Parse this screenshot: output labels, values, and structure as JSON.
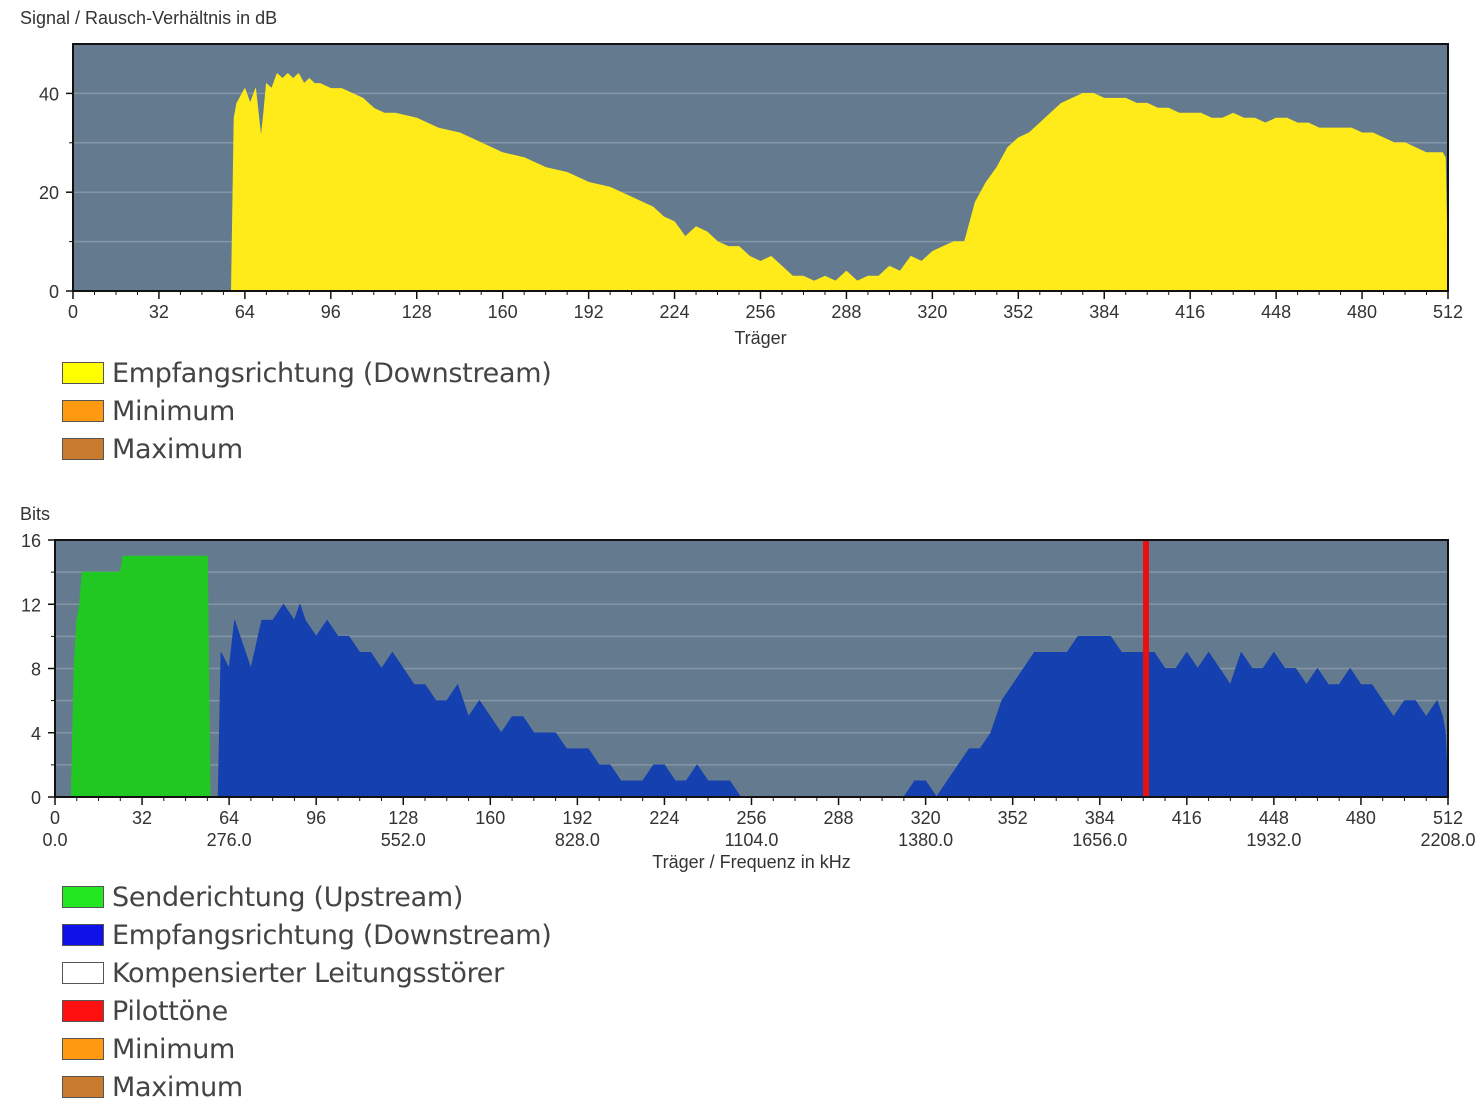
{
  "chart_data": [
    {
      "type": "area",
      "title": "Signal / Rausch-Verhältnis in dB",
      "xlabel": "Träger",
      "xlim": [
        0,
        512
      ],
      "ylim": [
        0,
        50
      ],
      "x_ticks": [
        0,
        32,
        64,
        96,
        128,
        160,
        192,
        224,
        256,
        288,
        320,
        352,
        384,
        416,
        448,
        480,
        512
      ],
      "y_ticks": [
        0,
        20,
        40
      ],
      "grid": true,
      "plot_background": "#647a8e",
      "series": [
        {
          "name": "Empfangsrichtung (Downstream)",
          "color": "#ffea1a",
          "x": [
            0,
            59,
            60,
            61,
            62,
            64,
            66,
            68,
            70,
            71,
            72,
            74,
            76,
            78,
            80,
            82,
            84,
            86,
            88,
            90,
            92,
            96,
            100,
            104,
            108,
            112,
            116,
            120,
            128,
            136,
            144,
            152,
            160,
            168,
            176,
            184,
            192,
            200,
            208,
            216,
            220,
            224,
            228,
            232,
            236,
            240,
            244,
            248,
            252,
            256,
            260,
            264,
            268,
            272,
            276,
            280,
            284,
            288,
            292,
            296,
            300,
            304,
            308,
            312,
            316,
            320,
            324,
            328,
            332,
            336,
            340,
            344,
            348,
            352,
            356,
            360,
            364,
            368,
            372,
            376,
            380,
            384,
            388,
            392,
            396,
            400,
            404,
            408,
            412,
            416,
            420,
            424,
            428,
            432,
            436,
            440,
            444,
            448,
            452,
            456,
            460,
            464,
            468,
            472,
            476,
            480,
            484,
            488,
            492,
            496,
            500,
            504,
            508,
            510,
            511,
            512
          ],
          "y": [
            0,
            0,
            35,
            38,
            39,
            41,
            38,
            41,
            31,
            36,
            42,
            41,
            44,
            43,
            44,
            43,
            44,
            42,
            43,
            42,
            42,
            41,
            41,
            40,
            39,
            37,
            36,
            36,
            35,
            33,
            32,
            30,
            28,
            27,
            25,
            24,
            22,
            21,
            19,
            17,
            15,
            14,
            11,
            13,
            12,
            10,
            9,
            9,
            7,
            6,
            7,
            5,
            3,
            3,
            2,
            3,
            2,
            4,
            2,
            3,
            3,
            5,
            4,
            7,
            6,
            8,
            9,
            10,
            10,
            18,
            22,
            25,
            29,
            31,
            32,
            34,
            36,
            38,
            39,
            40,
            40,
            39,
            39,
            39,
            38,
            38,
            37,
            37,
            36,
            36,
            36,
            35,
            35,
            36,
            35,
            35,
            34,
            35,
            35,
            34,
            34,
            33,
            33,
            33,
            33,
            32,
            32,
            31,
            30,
            30,
            29,
            28,
            28,
            28,
            27,
            0
          ]
        },
        {
          "name": "Minimum",
          "color": "#ff9a10",
          "x": [],
          "y": []
        },
        {
          "name": "Maximum",
          "color": "#c87a2e",
          "x": [],
          "y": []
        }
      ]
    },
    {
      "type": "area",
      "title": "Bits",
      "xlabel": "Träger / Frequenz in kHz",
      "xlim": [
        0,
        512
      ],
      "ylim": [
        0,
        16
      ],
      "x_ticks": [
        0,
        32,
        64,
        96,
        128,
        160,
        192,
        224,
        256,
        288,
        320,
        352,
        384,
        416,
        448,
        480,
        512
      ],
      "freq_ticks": [
        "0.0",
        "276.0",
        "552.0",
        "828.0",
        "1104.0",
        "1380.0",
        "1656.0",
        "1932.0",
        "2208.0"
      ],
      "y_ticks": [
        0,
        4,
        8,
        12,
        16
      ],
      "grid": true,
      "plot_background": "#647a8e",
      "series": [
        {
          "name": "Senderichtung (Upstream)",
          "color": "#22c822",
          "x": [
            6,
            7,
            8,
            9,
            10,
            12,
            24,
            25,
            56,
            57
          ],
          "y": [
            0,
            8,
            11,
            12,
            14,
            14,
            14,
            15,
            15,
            0
          ]
        },
        {
          "name": "Empfangsrichtung (Downstream)",
          "color": "#1540b0",
          "x": [
            60,
            61,
            64,
            66,
            68,
            72,
            76,
            80,
            84,
            88,
            90,
            92,
            96,
            100,
            104,
            108,
            112,
            116,
            120,
            124,
            128,
            132,
            136,
            140,
            144,
            148,
            152,
            156,
            160,
            164,
            168,
            172,
            176,
            180,
            184,
            188,
            192,
            196,
            200,
            204,
            208,
            212,
            216,
            220,
            224,
            228,
            232,
            236,
            240,
            244,
            248,
            252,
            256,
            260,
            264,
            268,
            272,
            276,
            280,
            284,
            288,
            292,
            296,
            300,
            304,
            308,
            312,
            316,
            320,
            324,
            328,
            332,
            336,
            340,
            344,
            348,
            352,
            356,
            360,
            364,
            368,
            372,
            376,
            380,
            384,
            388,
            392,
            396,
            400,
            404,
            408,
            412,
            416,
            420,
            424,
            428,
            432,
            436,
            440,
            444,
            448,
            452,
            456,
            460,
            464,
            468,
            472,
            476,
            480,
            484,
            488,
            492,
            496,
            500,
            504,
            508,
            510,
            511,
            512
          ],
          "y": [
            0,
            9,
            8,
            11,
            10,
            8,
            11,
            11,
            12,
            11,
            12,
            11,
            10,
            11,
            10,
            10,
            9,
            9,
            8,
            9,
            8,
            7,
            7,
            6,
            6,
            7,
            5,
            6,
            5,
            4,
            5,
            5,
            4,
            4,
            4,
            3,
            3,
            3,
            2,
            2,
            1,
            1,
            1,
            2,
            2,
            1,
            1,
            2,
            1,
            1,
            1,
            0,
            0,
            0,
            0,
            0,
            0,
            0,
            0,
            0,
            0,
            0,
            0,
            0,
            0,
            0,
            0,
            1,
            1,
            0,
            1,
            2,
            3,
            3,
            4,
            6,
            7,
            8,
            9,
            9,
            9,
            9,
            10,
            10,
            10,
            10,
            9,
            9,
            9,
            9,
            8,
            8,
            9,
            8,
            9,
            8,
            7,
            9,
            8,
            8,
            9,
            8,
            8,
            7,
            8,
            7,
            7,
            8,
            7,
            7,
            6,
            5,
            6,
            6,
            5,
            6,
            5,
            4,
            0
          ]
        },
        {
          "name": "Kompensierter Leitungsstörer",
          "color": "#ffffff",
          "x": [],
          "y": []
        },
        {
          "name": "Pilottöne",
          "color": "#ff1010",
          "x": [
            401
          ],
          "y": [
            16
          ]
        },
        {
          "name": "Minimum",
          "color": "#ff9a10",
          "x": [],
          "y": []
        },
        {
          "name": "Maximum",
          "color": "#c87a2e",
          "x": [],
          "y": []
        }
      ]
    }
  ],
  "legends": {
    "snr": [
      {
        "label": "Empfangsrichtung (Downstream)",
        "color": "#ffff00"
      },
      {
        "label": "Minimum",
        "color": "#ff9a10"
      },
      {
        "label": "Maximum",
        "color": "#c87a2e"
      }
    ],
    "bits": [
      {
        "label": "Senderichtung (Upstream)",
        "color": "#22e822"
      },
      {
        "label": "Empfangsrichtung (Downstream)",
        "color": "#1010e8"
      },
      {
        "label": "Kompensierter Leitungsstörer",
        "color": "#ffffff"
      },
      {
        "label": "Pilottöne",
        "color": "#ff1010"
      },
      {
        "label": "Minimum",
        "color": "#ff9a10"
      },
      {
        "label": "Maximum",
        "color": "#c87a2e"
      }
    ]
  }
}
